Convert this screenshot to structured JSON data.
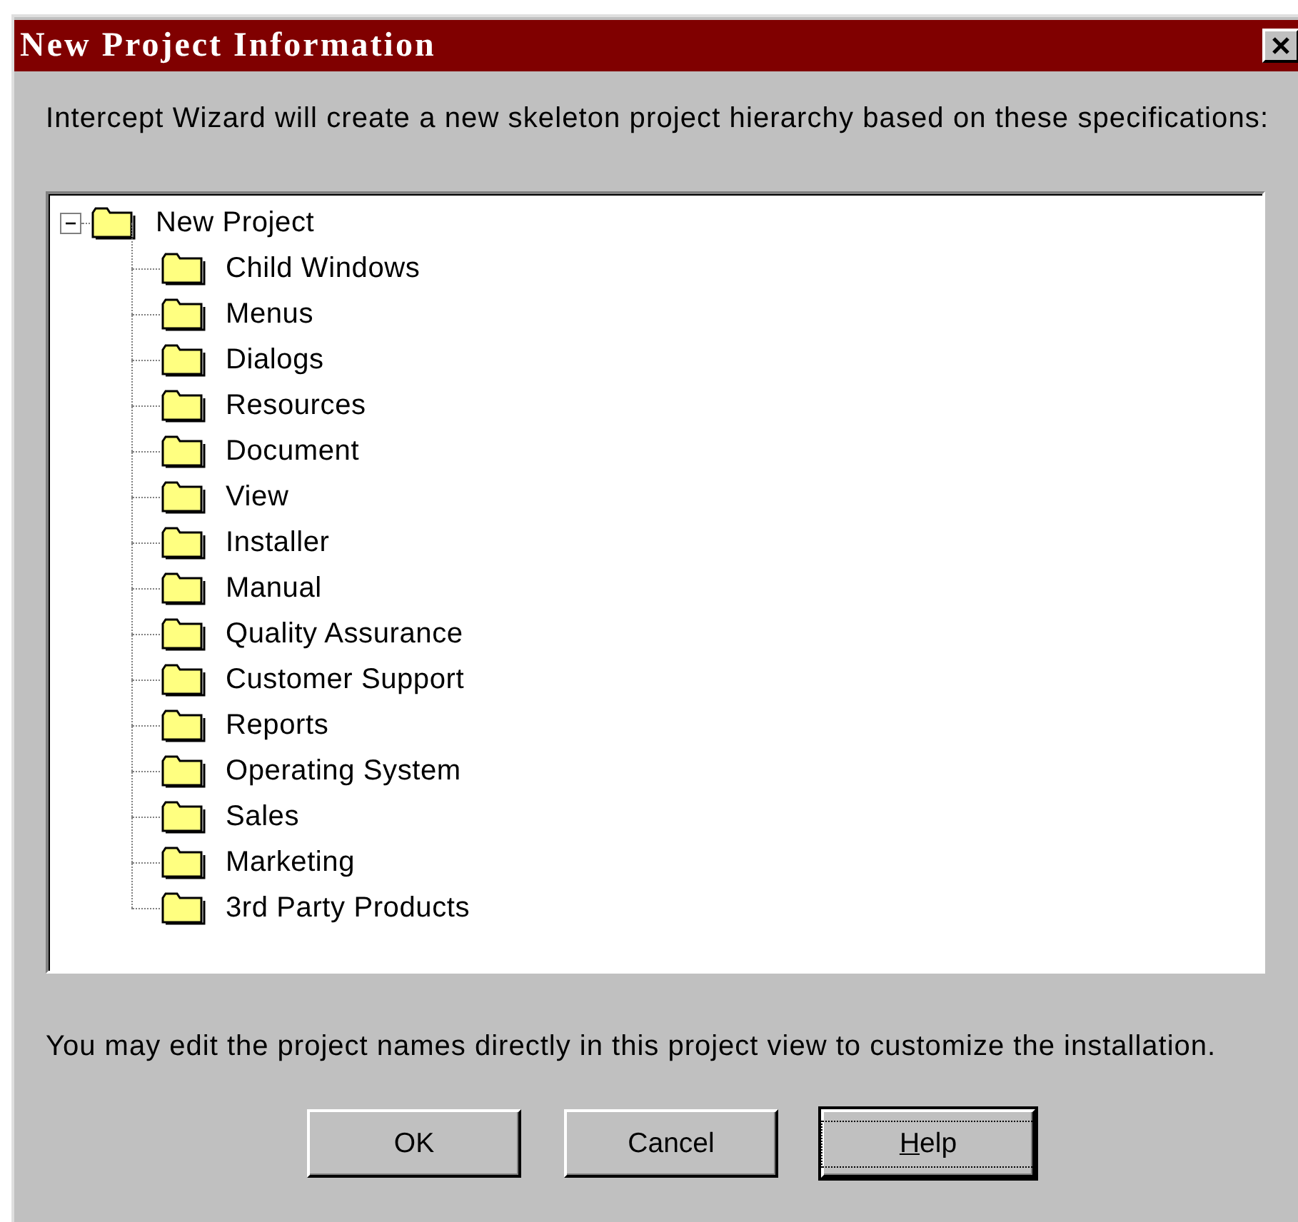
{
  "window": {
    "title": "New Project Information"
  },
  "intro": "Intercept Wizard will create a new skeleton project hierarchy based on these specifications:",
  "tree": [
    {
      "label": "New Project",
      "expanded": true,
      "children": [
        {
          "label": "Child Windows"
        },
        {
          "label": "Menus"
        },
        {
          "label": "Dialogs"
        },
        {
          "label": "Resources"
        },
        {
          "label": "Document"
        },
        {
          "label": "View"
        },
        {
          "label": "Installer"
        },
        {
          "label": "Manual"
        },
        {
          "label": "Quality Assurance"
        },
        {
          "label": "Customer Support"
        },
        {
          "label": "Reports"
        },
        {
          "label": "Operating System"
        },
        {
          "label": "Sales"
        },
        {
          "label": "Marketing"
        },
        {
          "label": "3rd Party Products"
        }
      ]
    }
  ],
  "note": "You may edit the project names directly in this project view to customize the installation.",
  "buttons": [
    {
      "label": "OK",
      "focused": false
    },
    {
      "label": "Cancel",
      "focused": false
    },
    {
      "label": "Help",
      "focused": true,
      "mnemonic_underlined": true
    }
  ]
}
